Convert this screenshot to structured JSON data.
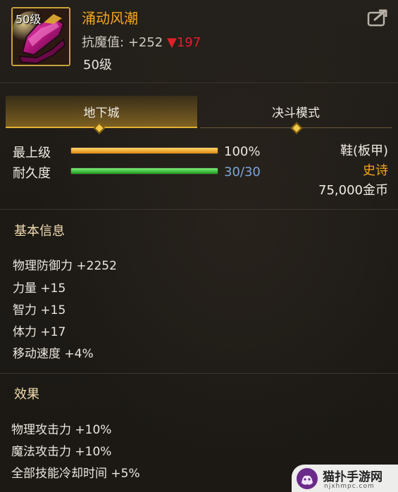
{
  "item": {
    "icon_level": "50级",
    "name": "涌动风潮",
    "resist_label": "抗魔值:",
    "resist_value": "+252",
    "resist_drop": "▼197",
    "level": "50级"
  },
  "tabs": [
    {
      "label": "地下城",
      "active": true
    },
    {
      "label": "决斗模式",
      "active": false
    }
  ],
  "bars": {
    "grade": {
      "label": "最上级",
      "value_text": "100%",
      "fill_fraction": 1.0
    },
    "durability": {
      "label": "耐久度",
      "value_text": "30/30",
      "fill_fraction": 1.0
    }
  },
  "meta": {
    "slot_type": "鞋(板甲)",
    "rarity": "史诗",
    "price": "75,000金币"
  },
  "basic_info": {
    "title": "基本信息",
    "lines": [
      "物理防御力 +2252",
      "力量 +15",
      "智力 +15",
      "体力 +17",
      "移动速度 +4%"
    ]
  },
  "effects": {
    "title": "效果",
    "lines": [
      "物理攻击力 +10%",
      "魔法攻击力 +10%",
      "全部技能冷却时间 +5%"
    ]
  },
  "watermark": {
    "title": "猫扑手游网",
    "domain": "njxhmpc.com"
  },
  "colors": {
    "item_name": "#f6a81e",
    "rarity": "#f2a51a",
    "resist_drop": "#e0202a",
    "durability_text": "#7aa6d8",
    "tab_accent": "#e3b034"
  },
  "icons": {
    "item": "epic-plate-boots-icon",
    "share": "share-export-icon",
    "tab_marker": "diamond-marker-icon",
    "watermark_logo": "cat-logo-icon"
  }
}
